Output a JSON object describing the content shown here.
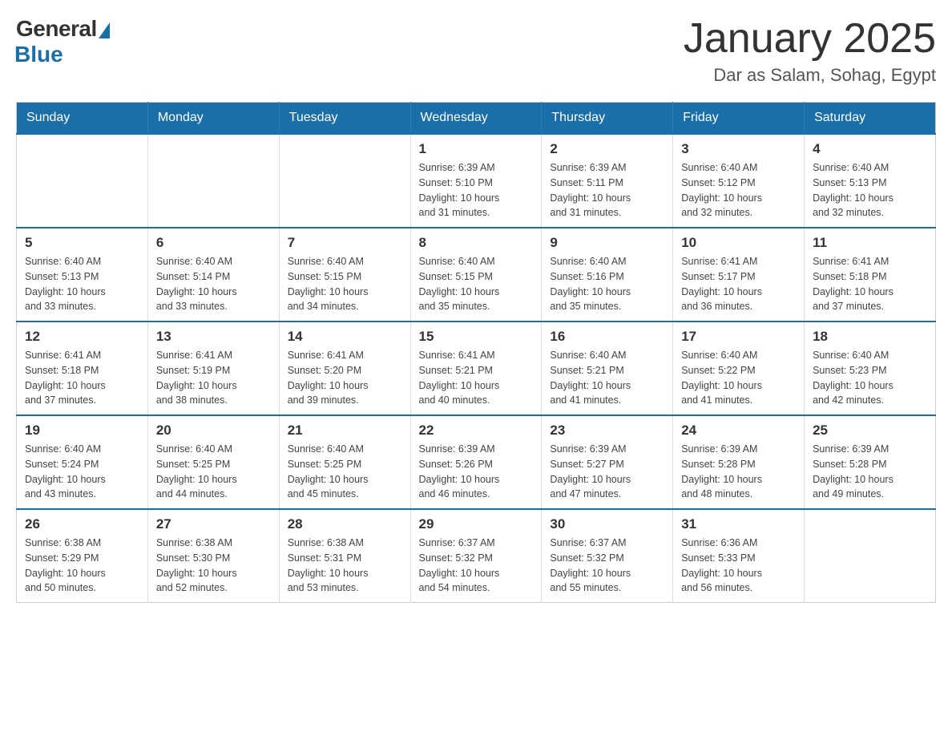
{
  "header": {
    "logo": {
      "general": "General",
      "blue": "Blue"
    },
    "title": "January 2025",
    "subtitle": "Dar as Salam, Sohag, Egypt"
  },
  "days_of_week": [
    "Sunday",
    "Monday",
    "Tuesday",
    "Wednesday",
    "Thursday",
    "Friday",
    "Saturday"
  ],
  "weeks": [
    [
      {
        "day": "",
        "info": ""
      },
      {
        "day": "",
        "info": ""
      },
      {
        "day": "",
        "info": ""
      },
      {
        "day": "1",
        "info": "Sunrise: 6:39 AM\nSunset: 5:10 PM\nDaylight: 10 hours\nand 31 minutes."
      },
      {
        "day": "2",
        "info": "Sunrise: 6:39 AM\nSunset: 5:11 PM\nDaylight: 10 hours\nand 31 minutes."
      },
      {
        "day": "3",
        "info": "Sunrise: 6:40 AM\nSunset: 5:12 PM\nDaylight: 10 hours\nand 32 minutes."
      },
      {
        "day": "4",
        "info": "Sunrise: 6:40 AM\nSunset: 5:13 PM\nDaylight: 10 hours\nand 32 minutes."
      }
    ],
    [
      {
        "day": "5",
        "info": "Sunrise: 6:40 AM\nSunset: 5:13 PM\nDaylight: 10 hours\nand 33 minutes."
      },
      {
        "day": "6",
        "info": "Sunrise: 6:40 AM\nSunset: 5:14 PM\nDaylight: 10 hours\nand 33 minutes."
      },
      {
        "day": "7",
        "info": "Sunrise: 6:40 AM\nSunset: 5:15 PM\nDaylight: 10 hours\nand 34 minutes."
      },
      {
        "day": "8",
        "info": "Sunrise: 6:40 AM\nSunset: 5:15 PM\nDaylight: 10 hours\nand 35 minutes."
      },
      {
        "day": "9",
        "info": "Sunrise: 6:40 AM\nSunset: 5:16 PM\nDaylight: 10 hours\nand 35 minutes."
      },
      {
        "day": "10",
        "info": "Sunrise: 6:41 AM\nSunset: 5:17 PM\nDaylight: 10 hours\nand 36 minutes."
      },
      {
        "day": "11",
        "info": "Sunrise: 6:41 AM\nSunset: 5:18 PM\nDaylight: 10 hours\nand 37 minutes."
      }
    ],
    [
      {
        "day": "12",
        "info": "Sunrise: 6:41 AM\nSunset: 5:18 PM\nDaylight: 10 hours\nand 37 minutes."
      },
      {
        "day": "13",
        "info": "Sunrise: 6:41 AM\nSunset: 5:19 PM\nDaylight: 10 hours\nand 38 minutes."
      },
      {
        "day": "14",
        "info": "Sunrise: 6:41 AM\nSunset: 5:20 PM\nDaylight: 10 hours\nand 39 minutes."
      },
      {
        "day": "15",
        "info": "Sunrise: 6:41 AM\nSunset: 5:21 PM\nDaylight: 10 hours\nand 40 minutes."
      },
      {
        "day": "16",
        "info": "Sunrise: 6:40 AM\nSunset: 5:21 PM\nDaylight: 10 hours\nand 41 minutes."
      },
      {
        "day": "17",
        "info": "Sunrise: 6:40 AM\nSunset: 5:22 PM\nDaylight: 10 hours\nand 41 minutes."
      },
      {
        "day": "18",
        "info": "Sunrise: 6:40 AM\nSunset: 5:23 PM\nDaylight: 10 hours\nand 42 minutes."
      }
    ],
    [
      {
        "day": "19",
        "info": "Sunrise: 6:40 AM\nSunset: 5:24 PM\nDaylight: 10 hours\nand 43 minutes."
      },
      {
        "day": "20",
        "info": "Sunrise: 6:40 AM\nSunset: 5:25 PM\nDaylight: 10 hours\nand 44 minutes."
      },
      {
        "day": "21",
        "info": "Sunrise: 6:40 AM\nSunset: 5:25 PM\nDaylight: 10 hours\nand 45 minutes."
      },
      {
        "day": "22",
        "info": "Sunrise: 6:39 AM\nSunset: 5:26 PM\nDaylight: 10 hours\nand 46 minutes."
      },
      {
        "day": "23",
        "info": "Sunrise: 6:39 AM\nSunset: 5:27 PM\nDaylight: 10 hours\nand 47 minutes."
      },
      {
        "day": "24",
        "info": "Sunrise: 6:39 AM\nSunset: 5:28 PM\nDaylight: 10 hours\nand 48 minutes."
      },
      {
        "day": "25",
        "info": "Sunrise: 6:39 AM\nSunset: 5:28 PM\nDaylight: 10 hours\nand 49 minutes."
      }
    ],
    [
      {
        "day": "26",
        "info": "Sunrise: 6:38 AM\nSunset: 5:29 PM\nDaylight: 10 hours\nand 50 minutes."
      },
      {
        "day": "27",
        "info": "Sunrise: 6:38 AM\nSunset: 5:30 PM\nDaylight: 10 hours\nand 52 minutes."
      },
      {
        "day": "28",
        "info": "Sunrise: 6:38 AM\nSunset: 5:31 PM\nDaylight: 10 hours\nand 53 minutes."
      },
      {
        "day": "29",
        "info": "Sunrise: 6:37 AM\nSunset: 5:32 PM\nDaylight: 10 hours\nand 54 minutes."
      },
      {
        "day": "30",
        "info": "Sunrise: 6:37 AM\nSunset: 5:32 PM\nDaylight: 10 hours\nand 55 minutes."
      },
      {
        "day": "31",
        "info": "Sunrise: 6:36 AM\nSunset: 5:33 PM\nDaylight: 10 hours\nand 56 minutes."
      },
      {
        "day": "",
        "info": ""
      }
    ]
  ]
}
